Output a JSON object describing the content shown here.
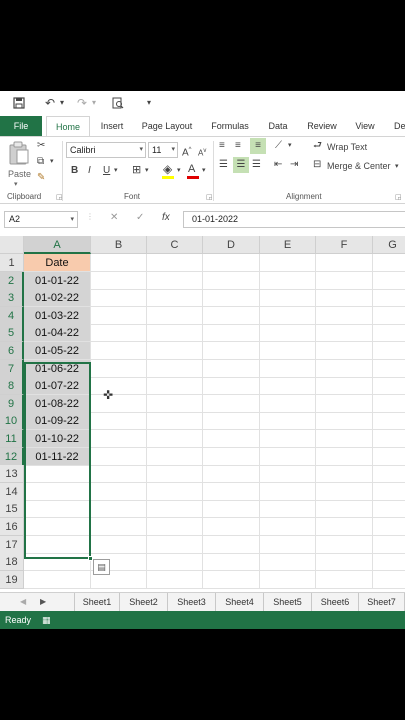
{
  "qat": {
    "save_icon": "save-icon",
    "undo_icon": "undo-icon",
    "redo_icon": "redo-icon",
    "preview_icon": "print-preview-icon"
  },
  "tabs": [
    "File",
    "Home",
    "Insert",
    "Page Layout",
    "Formulas",
    "Data",
    "Review",
    "View",
    "Dev"
  ],
  "ribbon": {
    "clipboard": {
      "paste": "Paste",
      "label": "Clipboard"
    },
    "font": {
      "name": "Calibri",
      "size": "11",
      "label": "Font",
      "bold": "B",
      "italic": "I",
      "underline": "U",
      "grow": "A",
      "shrink": "A",
      "font_color": "A"
    },
    "alignment": {
      "wrap": "Wrap Text",
      "merge": "Merge & Center",
      "label": "Alignment"
    }
  },
  "formula_bar": {
    "name_box": "A2",
    "cancel": "✕",
    "enter": "✓",
    "fx": "fx",
    "value": "01-01-2022"
  },
  "columns": [
    "A",
    "B",
    "C",
    "D",
    "E",
    "F",
    "G"
  ],
  "rows": [
    "1",
    "2",
    "3",
    "4",
    "5",
    "6",
    "7",
    "8",
    "9",
    "10",
    "11",
    "12",
    "13",
    "14",
    "15",
    "16",
    "17",
    "18",
    "19"
  ],
  "cells": {
    "header": "Date",
    "dates": [
      "01-01-22",
      "01-02-22",
      "01-03-22",
      "01-04-22",
      "01-05-22",
      "01-06-22",
      "01-07-22",
      "01-08-22",
      "01-09-22",
      "01-10-22",
      "01-11-22"
    ]
  },
  "sheets": [
    "Sheet1",
    "Sheet2",
    "Sheet3",
    "Sheet4",
    "Sheet5",
    "Sheet6",
    "Sheet7"
  ],
  "status": {
    "text": "Ready"
  },
  "colors": {
    "excel_green": "#217346",
    "header_fill": "#f8cbad",
    "selection_fill": "#d4d4d4"
  }
}
